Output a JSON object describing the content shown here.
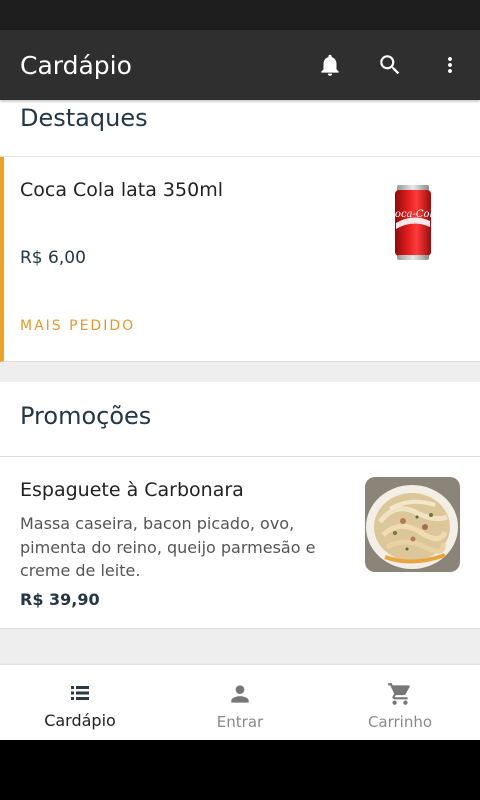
{
  "app_bar": {
    "title": "Cardápio",
    "icons": [
      "bell-icon",
      "search-icon",
      "more-vert-icon"
    ]
  },
  "featured": {
    "section_title": "Destaques",
    "item": {
      "name": "Coca Cola lata 350ml",
      "price": "R$ 6,00",
      "tag": "MAIS PEDIDO",
      "image_label": "Coca-Cola"
    }
  },
  "promos": {
    "section_title": "Promoções",
    "item": {
      "name": "Espaguete à Carbonara",
      "description": "Massa caseira, bacon picado, ovo, pimenta do reino, queijo parmesão e creme de leite.",
      "price": "R$ 39,90"
    }
  },
  "bottom_nav": {
    "items": [
      {
        "label": "Cardápio",
        "icon": "list-icon",
        "active": true
      },
      {
        "label": "Entrar",
        "icon": "person-icon",
        "active": false
      },
      {
        "label": "Carrinho",
        "icon": "cart-icon",
        "active": false
      }
    ]
  },
  "colors": {
    "app_bar": "#2f2f2f",
    "accent": "#f0a023",
    "heading": "#243746"
  }
}
